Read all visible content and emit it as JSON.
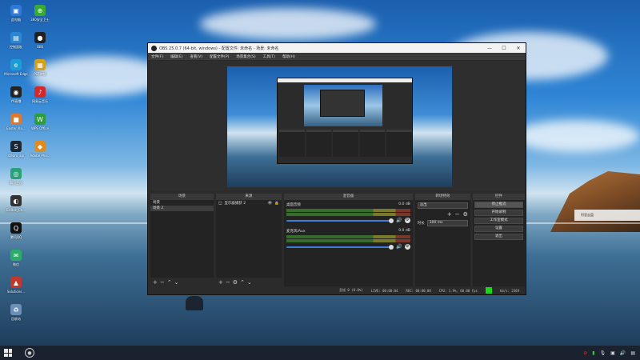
{
  "desktop": {
    "icons": [
      {
        "label": "此电脑",
        "color": "#2f7ad8",
        "glyph": "▣"
      },
      {
        "label": "控制面板",
        "color": "#2c86d4",
        "glyph": "▤"
      },
      {
        "label": "Microsoft Edge",
        "color": "#1d9bd6",
        "glyph": "e"
      },
      {
        "label": "Y9直播",
        "color": "#222222",
        "glyph": "◉"
      },
      {
        "label": "Easter_Kn...",
        "color": "#e0782a",
        "glyph": "■"
      },
      {
        "label": "steam_api",
        "color": "#1b2838",
        "glyph": "S"
      },
      {
        "label": "腾讯会议",
        "color": "#28a07a",
        "glyph": "◎"
      },
      {
        "label": "Elsdoc_Ch...",
        "color": "#333333",
        "glyph": "◐"
      },
      {
        "label": "腾讯QQ",
        "color": "#111111",
        "glyph": "Q"
      },
      {
        "label": "微信",
        "color": "#2aae67",
        "glyph": "✉"
      },
      {
        "label": "Solutions...",
        "color": "#c0392b",
        "glyph": "▲"
      },
      {
        "label": "回收站",
        "color": "#6b8fb5",
        "glyph": "♻"
      },
      {
        "label": "360安全卫士",
        "color": "#3aaa35",
        "glyph": "⊕"
      },
      {
        "label": "OBS",
        "color": "#222222",
        "glyph": "●"
      },
      {
        "label": "PDF转换",
        "color": "#d4a020",
        "glyph": "▦"
      },
      {
        "label": "网易云音乐",
        "color": "#d22a2a",
        "glyph": "♪"
      },
      {
        "label": "WPS Office",
        "color": "#2d9c3a",
        "glyph": "W"
      },
      {
        "label": "Adobe Pho...",
        "color": "#e08b1f",
        "glyph": "◆"
      }
    ]
  },
  "notification": {
    "text": "阿里云盘"
  },
  "obs": {
    "title": "OBS 25.0.7 (64-bit, windows) - 配置文件: 未命名 - 场景: 未命名",
    "menu": [
      "文件(F)",
      "编辑(E)",
      "查看(V)",
      "配置文件(P)",
      "场景集合(S)",
      "工具(T)",
      "帮助(H)"
    ],
    "docks": {
      "scenes": {
        "header": "场景",
        "items": [
          "场景",
          "场景 2"
        ]
      },
      "sources": {
        "header": "来源",
        "items": [
          "显示器捕获 2"
        ]
      },
      "mixer": {
        "header": "混音器",
        "channels": [
          {
            "name": "桌面音频",
            "db": "0.0 dB"
          },
          {
            "name": "麦克风/Aux",
            "db": "0.0 dB"
          }
        ]
      },
      "transitions": {
        "header": "转场特效",
        "selected": "淡出",
        "duration_label": "时长",
        "duration_value": "300 ms"
      },
      "controls": {
        "header": "控件",
        "buttons": [
          "停止推流",
          "开始录制",
          "工作室模式",
          "设置",
          "退出"
        ]
      }
    },
    "status": {
      "dropped": "丢帧 0 (0.0%)",
      "live": "LIVE: 00:00:04",
      "rec": "REC: 00:00:00",
      "cpu": "CPU: 1.9%, 60.00 fps",
      "kbps": "kb/s: 2369"
    }
  }
}
